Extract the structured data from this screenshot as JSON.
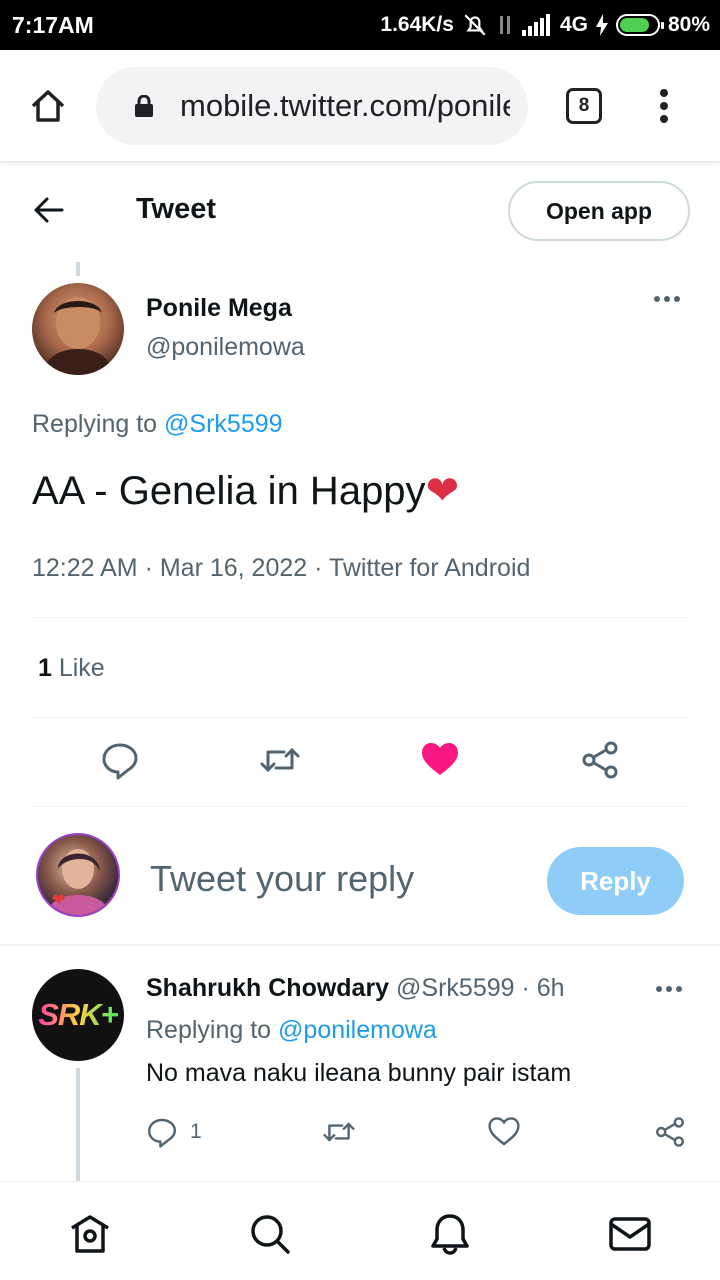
{
  "status_bar": {
    "time": "7:17AM",
    "speed": "1.64K/s",
    "network": "4G",
    "battery": "80%",
    "battery_level": 0.8
  },
  "browser": {
    "url": "mobile.twitter.com/ponilemowa",
    "tab_count": "8"
  },
  "header": {
    "title": "Tweet",
    "open_app": "Open app"
  },
  "tweet": {
    "author_name": "Ponile Mega",
    "author_handle": "@ponilemowa",
    "replying_prefix": "Replying to ",
    "replying_handle": "@Srk5599",
    "text": "AA - Genelia in Happy",
    "emoji": "❤",
    "meta": "12:22 AM · Mar 16, 2022 · Twitter for Android",
    "likes_count": "1",
    "likes_label": " Like",
    "liked": true
  },
  "compose": {
    "placeholder": "Tweet your reply",
    "reply_button": "Reply"
  },
  "reply": {
    "avatar_text": "SRK+",
    "author_name": "Shahrukh Chowdary",
    "meta": " @Srk5599 · 6h",
    "replying_prefix": "Replying to ",
    "replying_handle": "@ponilemowa",
    "text": "No mava naku ileana bunny pair istam",
    "reply_count": "1"
  },
  "colors": {
    "accent": "#1d9bf0",
    "like": "#f91880",
    "reply_button": "#8ecdf8",
    "secondary_text": "#536471"
  },
  "icons": {
    "bottom_nav": [
      "home-icon",
      "search-icon",
      "notifications-icon",
      "messages-icon"
    ]
  }
}
